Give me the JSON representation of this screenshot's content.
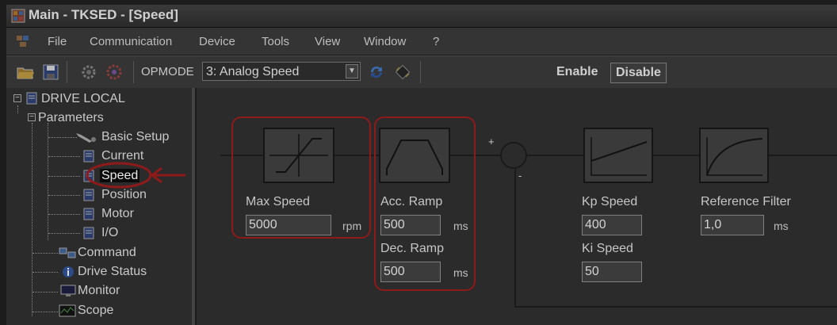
{
  "window": {
    "title": "Main - TKSED - [Speed]"
  },
  "menu": [
    "File",
    "Communication",
    "Device",
    "Tools",
    "View",
    "Window",
    "?"
  ],
  "toolbar": {
    "opmode_label": "OPMODE",
    "opmode_value": "3: Analog Speed",
    "enable_label": "Enable",
    "disable_label": "Disable"
  },
  "tree": {
    "root": "DRIVE LOCAL",
    "parameters": "Parameters",
    "items": [
      "Basic Setup",
      "Current",
      "Speed",
      "Position",
      "Motor",
      "I/O"
    ],
    "after": [
      "Command",
      "Drive Status",
      "Monitor",
      "Scope"
    ]
  },
  "diagram": {
    "max_speed": {
      "label": "Max Speed",
      "value": "5000",
      "unit": "rpm"
    },
    "acc_ramp": {
      "label": "Acc. Ramp",
      "value": "500",
      "unit": "ms"
    },
    "dec_ramp": {
      "label": "Dec. Ramp",
      "value": "500",
      "unit": "ms"
    },
    "kp_speed": {
      "label": "Kp Speed",
      "value": "400"
    },
    "ki_speed": {
      "label": "Ki Speed",
      "value": "50"
    },
    "ref_filter": {
      "label": "Reference Filter",
      "value": "1,0",
      "unit": "ms"
    },
    "sum_plus": "+",
    "sum_minus": "-"
  },
  "colors": {
    "highlight_ring": "#8e1a1a",
    "background": "#2b2b2b"
  }
}
